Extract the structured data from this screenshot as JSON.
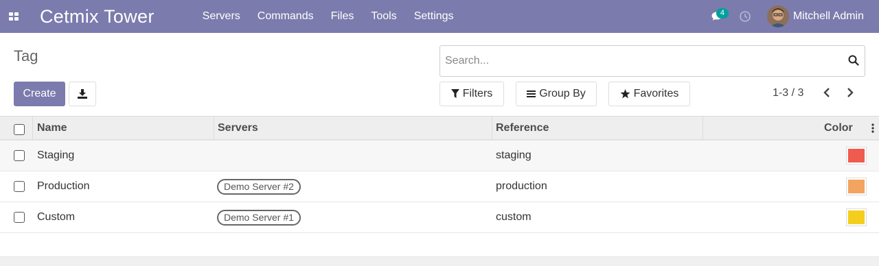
{
  "navbar": {
    "brand": "Cetmix Tower",
    "menu": [
      "Servers",
      "Commands",
      "Files",
      "Tools",
      "Settings"
    ],
    "messages_count": "4",
    "user_name": "Mitchell Admin"
  },
  "control_panel": {
    "breadcrumb": "Tag",
    "search_placeholder": "Search...",
    "create_label": "Create",
    "filters_label": "Filters",
    "groupby_label": "Group By",
    "favorites_label": "Favorites",
    "pager": "1-3 / 3"
  },
  "table": {
    "headers": {
      "name": "Name",
      "servers": "Servers",
      "reference": "Reference",
      "color": "Color"
    },
    "rows": [
      {
        "name": "Staging",
        "servers": "",
        "reference": "staging",
        "color": "#ef5b4f"
      },
      {
        "name": "Production",
        "servers": "Demo Server #2",
        "reference": "production",
        "color": "#f2a460"
      },
      {
        "name": "Custom",
        "servers": "Demo Server #1",
        "reference": "custom",
        "color": "#f5cd1c"
      }
    ]
  },
  "colors": {
    "navbar": "#7c7bad",
    "primary_button": "#7c7bad",
    "badge": "#00a09d"
  }
}
